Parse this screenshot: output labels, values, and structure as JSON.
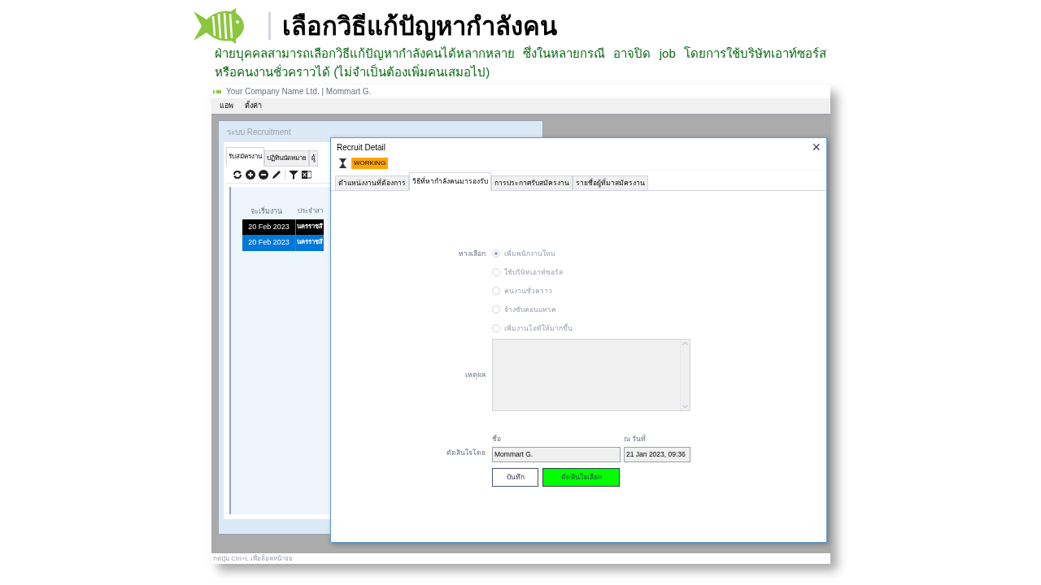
{
  "slide": {
    "title": "เลือกวิธีแก้ปัญหากำลังคน",
    "subtitle": "ฝ่ายบุคคลสามารถเลือกวิธีแก้ปัญหากำลังคนได้หลากหลาย ซึ่งในหลายกรณี อาจปิด job โดยการใช้บริษัทเอาท์ซอร์ส หรือคนงานชั่วคราวได้ (ไม่จำเป็นต้องเพิ่มคนเสมอไป)"
  },
  "app": {
    "title": "Your Company Name Ltd. | Mommart G.",
    "menu": [
      "แอพ",
      "ตั้งค่า"
    ],
    "status_bar": "กดปุ่ม Ctrl+L เพื่อล็อคหน้าจอ"
  },
  "main_window": {
    "title": "ระบบ Recruitment",
    "tabs": [
      {
        "label": "รับสมัครงาน",
        "selected": true
      },
      {
        "label": "ปฏิทินนัดหมาย",
        "selected": false
      },
      {
        "label": "ผู้",
        "selected": false
      }
    ],
    "table": {
      "columns": [
        "จะเริ่มงาน",
        "ประจำสา"
      ],
      "rows": [
        {
          "cells": [
            "20 Feb 2023",
            "นครราชสี"
          ],
          "color": "#000000"
        },
        {
          "cells": [
            "20 Feb 2023",
            "นครราชสี"
          ],
          "color": "#0078d7"
        }
      ]
    }
  },
  "dialog": {
    "title": "Recruit Detail",
    "close": "×",
    "status": "WORKING",
    "tabs": [
      {
        "label": "ตำแหน่งงานที่ต้องการ",
        "selected": false
      },
      {
        "label": "วิธีที่หากำลังคนมารองรับ",
        "selected": true
      },
      {
        "label": "การประกาศรับสมัครงาน",
        "selected": false
      },
      {
        "label": "รายชื่อผู้ที่มาสมัครงาน",
        "selected": false
      }
    ],
    "options_label": "ทางเลือก",
    "options": [
      {
        "label": "เพิ่มพนักงานใหม่",
        "selected": true
      },
      {
        "label": "ใช้บริษัทเอาท์ซอร์ส",
        "selected": false
      },
      {
        "label": "คนงานชั่วคราว",
        "selected": false
      },
      {
        "label": "จ้างซับคอนแทรค",
        "selected": false
      },
      {
        "label": "เพิ่มงานโอทีให้มากขึ้น",
        "selected": false
      }
    ],
    "reason_label": "เหตุผล",
    "decided_by_label": "ตัดสินใจโดย",
    "name_label": "ชื่อ",
    "name_value": "Mommart G.",
    "date_label": "ณ วันที่",
    "date_value": "21 Jan 2023, 09:36",
    "buttons": [
      {
        "label": "บันทึก",
        "kind": "plain"
      },
      {
        "label": "ตัดสินใจเลือก",
        "kind": "primary"
      }
    ]
  }
}
